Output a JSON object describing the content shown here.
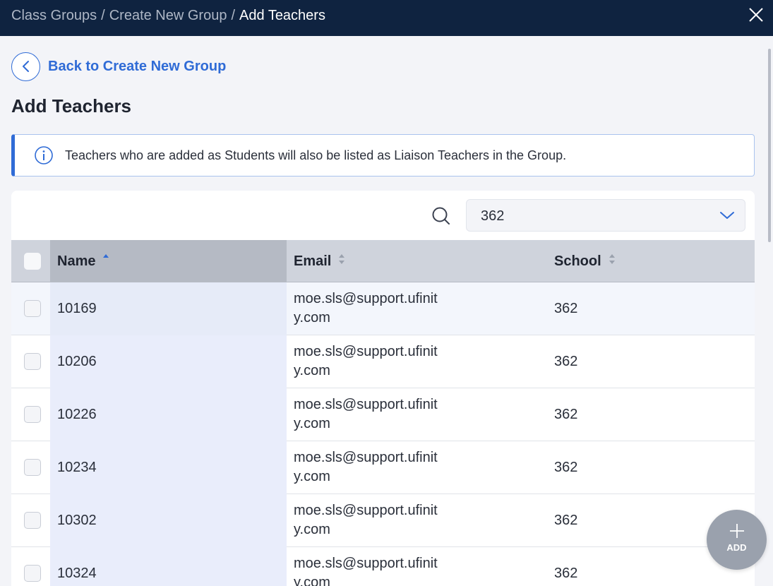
{
  "breadcrumb": {
    "items": [
      "Class Groups",
      "Create New Group"
    ],
    "separator": "/",
    "current": "Add Teachers"
  },
  "back_link": {
    "label": "Back to Create New Group"
  },
  "page_title": "Add Teachers",
  "info_banner": {
    "text": "Teachers who are added as Students will also be listed as Liaison Teachers in the Group."
  },
  "filter": {
    "selected": "362"
  },
  "table": {
    "columns": {
      "name": "Name",
      "email": "Email",
      "school": "School"
    },
    "rows": [
      {
        "name": "10169",
        "email": "moe.sls@support.ufinity.com",
        "school": "362"
      },
      {
        "name": "10206",
        "email": "moe.sls@support.ufinity.com",
        "school": "362"
      },
      {
        "name": "10226",
        "email": "moe.sls@support.ufinity.com",
        "school": "362"
      },
      {
        "name": "10234",
        "email": "moe.sls@support.ufinity.com",
        "school": "362"
      },
      {
        "name": "10302",
        "email": "moe.sls@support.ufinity.com",
        "school": "362"
      },
      {
        "name": "10324",
        "email": "moe.sls@support.ufinity.com",
        "school": "362"
      }
    ]
  },
  "fab": {
    "label": "ADD"
  },
  "colors": {
    "topbar": "#0f2340",
    "accent": "#2f6bd6",
    "fab": "#9aa1ad"
  }
}
